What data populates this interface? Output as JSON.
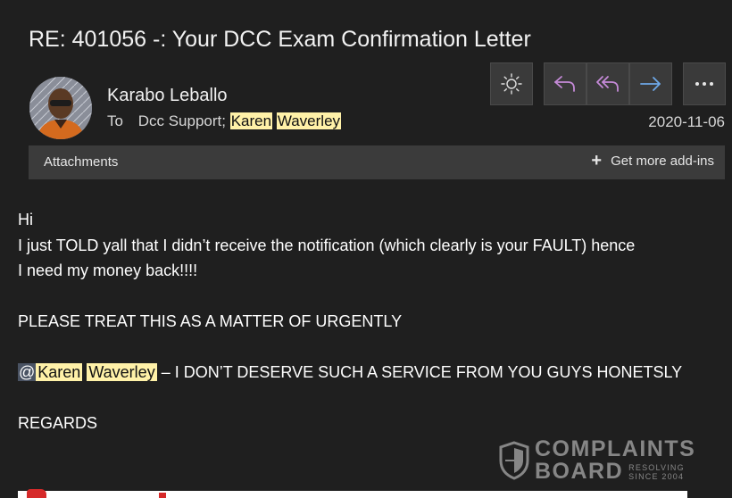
{
  "email": {
    "subject": "RE: 401056 -: Your DCC Exam Confirmation Letter",
    "sender": "Karabo Leballo",
    "to_label": "To",
    "recipients": [
      "Dcc Support;",
      "Karen",
      "Waverley"
    ],
    "date": "2020-11-06"
  },
  "toolbar": {
    "buttons": [
      {
        "name": "theme-toggle",
        "icon": "sun-icon"
      },
      {
        "name": "reply",
        "icon": "reply-icon",
        "color": "#c58ad8"
      },
      {
        "name": "reply-all",
        "icon": "reply-all-icon",
        "color": "#c58ad8"
      },
      {
        "name": "forward",
        "icon": "forward-icon",
        "color": "#6ea8e8"
      },
      {
        "name": "more",
        "icon": "more-icon"
      }
    ]
  },
  "addin_bar": {
    "attachments_label": "Attachments",
    "get_addins_label": "Get more add-ins"
  },
  "body": {
    "greeting": "Hi",
    "line1": "I just TOLD yall that I didn’t receive the notification (which clearly is your FAULT) hence",
    "line2": "I need my money back!!!!",
    "urgent": "PLEASE TREAT THIS AS A MATTER OF URGENTLY",
    "mention_at": "@",
    "mention_first": "Karen",
    "mention_last": "Waverley",
    "mention_text": " – I DON’T DESERVE SUCH A SERVICE FROM YOU GUYS HONETSLY",
    "signoff": "REGARDS"
  },
  "watermark": {
    "line1": "COMPLAINTS",
    "line2": "BOARD",
    "tag1": "RESOLVING",
    "tag2": "SINCE 2004"
  },
  "colors": {
    "background": "#1f1f1f",
    "highlight": "#fff1a8",
    "reply_accent": "#c58ad8",
    "forward_accent": "#6ea8e8"
  }
}
